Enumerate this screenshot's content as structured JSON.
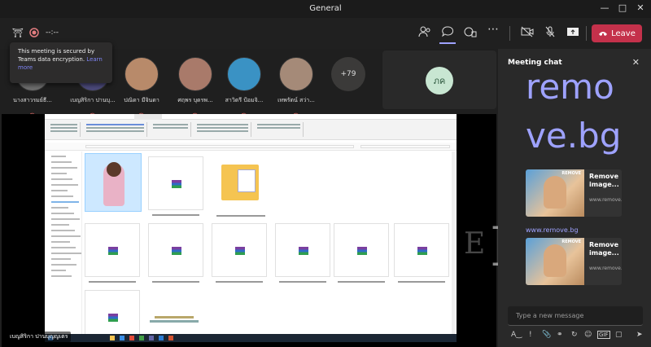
{
  "window": {
    "title": "General"
  },
  "toolbar": {
    "timer": "--:--",
    "leave_label": "Leave"
  },
  "tooltip": {
    "text": "This meeting is secured by Teams data encryption.",
    "link": "Learn more"
  },
  "participants": [
    {
      "name": "นางสาวรมย์ธี...",
      "color": "#6d6d6d"
    },
    {
      "name": "เบญสิริกา ปานบุ...",
      "color": "#4b4a7a"
    },
    {
      "name": "ปณิดา มีจินดา",
      "color": "#b88a6a"
    },
    {
      "name": "ศฤพร บุดรพ...",
      "color": "#a97a6a"
    },
    {
      "name": "สาวิตรี ป้อมจิ...",
      "color": "#3a92c4"
    },
    {
      "name": "เทพรัตน์ สว่า...",
      "color": "#a58a78"
    }
  ],
  "more_count": "+79",
  "side_tile": {
    "initials": "ภค"
  },
  "stage": {
    "speaker_name": "เบญสิริกา ปานบุญญเตร"
  },
  "chat": {
    "title": "Meeting chat",
    "big_text_1": "remo",
    "big_text_2": "ve.bg",
    "card_title": "Remove image...",
    "card_url": "www.remove.bg",
    "link_text": "www.remove.bg",
    "placeholder": "Type a new message"
  },
  "colors": {
    "accent": "#9ea2ff",
    "leave": "#c4314b",
    "panel": "#292929"
  }
}
